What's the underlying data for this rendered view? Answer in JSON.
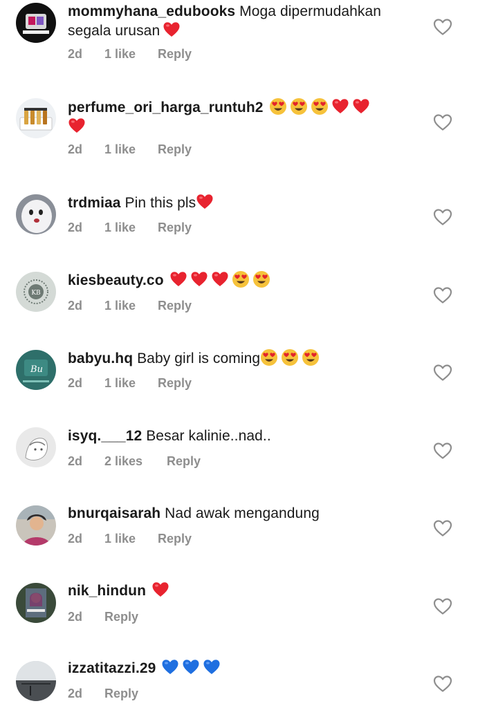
{
  "comments": [
    {
      "username": "mommyhana_edubooks",
      "text": "Moga dipermudahkan",
      "text2": "segala urusan",
      "time": "2d",
      "likes": "1 like",
      "reply": "Reply"
    },
    {
      "username": "perfume_ori_harga_runtuh2",
      "text": "",
      "time": "2d",
      "likes": "1 like",
      "reply": "Reply"
    },
    {
      "username": "trdmiaa",
      "text": "Pin this pls",
      "time": "2d",
      "likes": "1 like",
      "reply": "Reply"
    },
    {
      "username": "kiesbeauty.co",
      "text": "",
      "time": "2d",
      "likes": "1 like",
      "reply": "Reply"
    },
    {
      "username": "babyu.hq",
      "text": "Baby girl is coming",
      "time": "2d",
      "likes": "1 like",
      "reply": "Reply"
    },
    {
      "username": "isyq.___12",
      "text": "Besar kalinie..nad..",
      "time": "2d",
      "likes": "2 likes",
      "reply": "Reply"
    },
    {
      "username": "bnurqaisarah",
      "text": "Nad awak mengandung",
      "time": "2d",
      "likes": "1 like",
      "reply": "Reply"
    },
    {
      "username": "nik_hindun",
      "text": "",
      "time": "2d",
      "reply": "Reply"
    },
    {
      "username": "izzatitazzi.29",
      "text": "",
      "time": "2d",
      "reply": "Reply"
    }
  ],
  "emoji": {
    "c1": [
      "red-heart"
    ],
    "c2_line1": [
      "heart-eyes",
      "heart-eyes",
      "heart-eyes",
      "red-heart",
      "red-heart"
    ],
    "c2_line2": [
      "red-heart"
    ],
    "c3": [
      "red-heart"
    ],
    "c4": [
      "red-heart",
      "red-heart",
      "red-heart",
      "heart-eyes",
      "heart-eyes"
    ],
    "c5": [
      "heart-eyes",
      "heart-eyes",
      "heart-eyes"
    ],
    "c8": [
      "red-heart"
    ],
    "c9": [
      "blue-heart",
      "blue-heart",
      "blue-heart"
    ]
  },
  "colors": {
    "meta": "#8e8e8e",
    "red_heart": "#e8232f",
    "blue_heart": "#1f6fe0",
    "emoji_face": "#f6c23b"
  }
}
